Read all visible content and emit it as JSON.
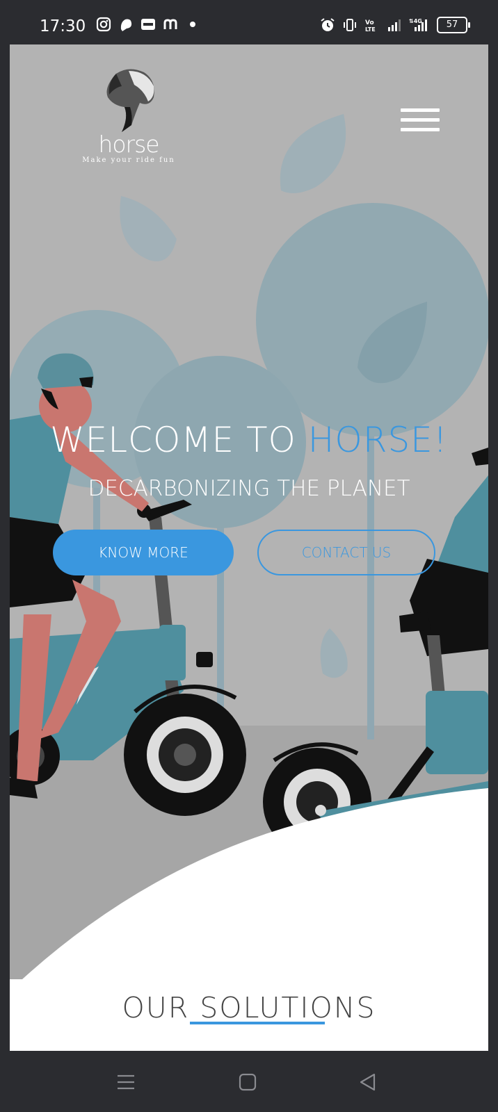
{
  "status_bar": {
    "time": "17:30",
    "left_icons": [
      "instagram-icon",
      "notification-app-icon",
      "paytm-icon",
      "m-app-icon",
      "dot-icon"
    ],
    "right_icons": [
      "alarm-icon",
      "vibrate-icon",
      "volte-icon",
      "signal-icon",
      "4g-signal-icon"
    ],
    "battery": "57"
  },
  "header": {
    "logo_word": "horse",
    "logo_tagline": "Make your ride fun",
    "menu_icon": "hamburger-menu-icon"
  },
  "hero": {
    "title_prefix": "WELCOME TO ",
    "title_accent": "HORSE!",
    "subtitle": "DECARBONIZING THE PLANET",
    "primary_button": "KNOW MORE",
    "secondary_button": "CONTACT US"
  },
  "solutions": {
    "title": "OUR SOLUTIONS"
  },
  "nav_bar": {
    "icons": [
      "menu-icon",
      "home-icon",
      "back-icon"
    ]
  },
  "colors": {
    "accent": "#3a97df",
    "hero_bg": "#b3b3b3",
    "system_bar": "#2b2c30"
  }
}
